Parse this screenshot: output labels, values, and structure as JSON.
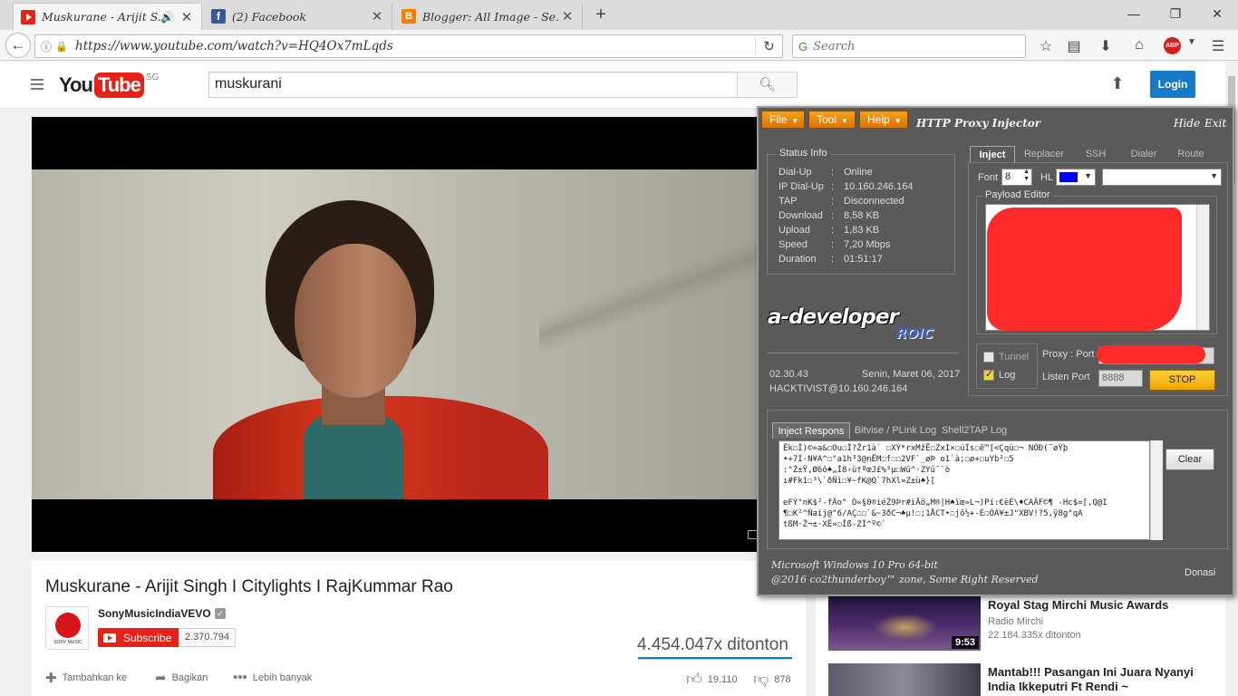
{
  "browser": {
    "tabs": [
      {
        "title": "Muskurane - Arijit S...",
        "favicon": "youtube-icon",
        "active": true,
        "audio": true
      },
      {
        "title": "(2) Facebook",
        "favicon": "facebook-icon",
        "active": false
      },
      {
        "title": "Blogger: All Image - Se...",
        "favicon": "blogger-icon",
        "active": false
      }
    ],
    "url": "https://www.youtube.com/watch?v=HQ4Ox7mLqds",
    "search_placeholder": "Search",
    "abp_label": "ABP"
  },
  "youtube": {
    "logo_you": "You",
    "logo_tube": "Tube",
    "logo_region": "SG",
    "search_query": "muskurani",
    "login_label": "Login",
    "video": {
      "title": "Muskurane - Arijit Singh I Citylights I RajKummar Rao",
      "channel": "SonyMusicIndiaVEVO",
      "channel_logo_text": "SONY MUSIC",
      "subscribe_label": "Subscribe",
      "subscriber_count": "2.370.794",
      "views": "4.454.047x ditonton",
      "actions": {
        "add": "Tambahkan ke",
        "share": "Bagikan",
        "more": "Lebih banyak"
      },
      "likes": "19.110",
      "dislikes": "878"
    },
    "related": [
      {
        "title": "Royal Stag Mirchi Music Awards",
        "channel": "Radio Mirchi",
        "views": "22.184.335x ditonton",
        "duration": "9:53"
      },
      {
        "title": "Mantab!!! Pasangan Ini Juara Nyanyi India Ikkeputri Ft Rendi ~",
        "channel": "",
        "views": "",
        "duration": ""
      }
    ]
  },
  "injector": {
    "menus": [
      "File",
      "Tool",
      "Help"
    ],
    "title": "HTTP Proxy Injector",
    "hide": "Hide",
    "exit": "Exit",
    "status_title": "Status Info",
    "status": [
      {
        "key": "Dial-Up",
        "value": "Online"
      },
      {
        "key": "IP Dial-Up",
        "value": "10.160.246.164"
      },
      {
        "key": "TAP",
        "value": "Disconnected"
      },
      {
        "key": "Download",
        "value": "8,58 KB"
      },
      {
        "key": "Upload",
        "value": "1,83 KB"
      },
      {
        "key": "Speed",
        "value": "7,20 Mbps"
      },
      {
        "key": "Duration",
        "value": "01:51:17"
      }
    ],
    "logo_main": "a-developer",
    "logo_sub": "ROIC",
    "version": "02.30.43",
    "date": "Senin, Maret 06, 2017",
    "user": "HACKTIVIST@10.160.246.164",
    "tabs": [
      "Inject",
      "Replacer",
      "SSH",
      "Dialer",
      "Route"
    ],
    "font_label": "Font",
    "font_size": "8",
    "hl_label": "HL",
    "hl_color": "#0000ff",
    "payload_label": "Payload Editor",
    "tunnel_label": "Tunnel",
    "log_label": "Log",
    "proxy_port_label": "Proxy : Port",
    "listen_port_label": "Listen Port",
    "listen_port": "8888",
    "stop_label": "STOP",
    "log_tabs": [
      "Inject Respons",
      "Bitvise / PLink Log",
      "Shell2TAP Log"
    ],
    "clear_label": "Clear",
    "log_lines": [
      "Ëk☐Î)©»a&☐Ou☐Î?Žr1à`  ☐XÝ*rxMžË☐ZxI×☐úÍs☐ë™[<Çqù☐¬ NÖÐ(˜øÝþ",
      "•+7Í·N¥A^☐\"a1h³3@nËM☐f☐☐2VF`_øÞ        o1`à;☐ø+☐uYb²☐5",
      ":\"Ž±Ÿ,Ø6ô♠„Î8›ù†ºœJ£%³µ☐Wü^·ZYû˜`ò",
      "ı#Fk1☐³\\`ðÑì☐¥~fK@Q`7hXl»Z±ù♠}[",
      "",
      "eFÝ\"nK$²-fÂo\" Ó«§0®iéŽ9Þr#iÄö„M®|H♠ïœ»L¬)Pí:€èÉ\\♦CAÂF©¶ -Hc$=[,Q@I",
      "¶☐K²^Ñaij@\"6/AÇ☐☐`&~3ðC¬♠µ!☐;1ÅCT•☐jô½+-É☐ÓÁ¥±J\"XBV!?5,ÿ8g°qA",
      "tßM·Ž¬±·XÊ»☐Îß-ZÎ^º©`"
    ],
    "os_text": "Microsoft Windows 10 Pro 64-bit",
    "copyright": "@2016 co2thunderboy™ zone, Some Right Reserved",
    "donasi": "Donasi"
  }
}
